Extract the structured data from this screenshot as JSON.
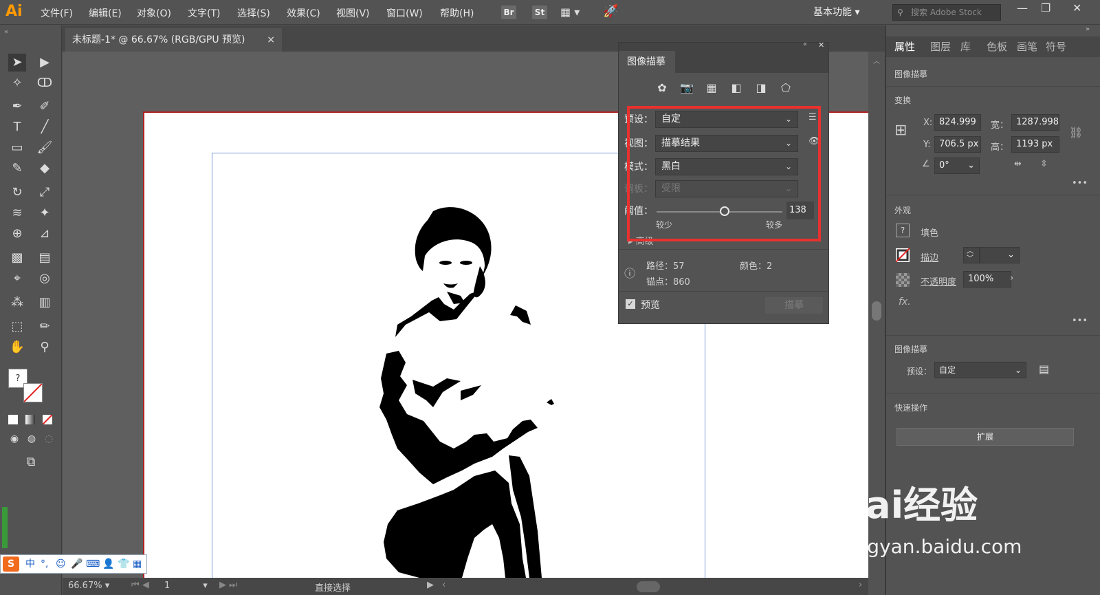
{
  "app": {
    "logo": "Ai",
    "menus": [
      "文件(F)",
      "编辑(E)",
      "对象(O)",
      "文字(T)",
      "选择(S)",
      "效果(C)",
      "视图(V)",
      "窗口(W)",
      "帮助(H)"
    ],
    "bridge": [
      "Br",
      "St"
    ],
    "workspace": "基本功能",
    "stock_placeholder": "搜索 Adobe Stock"
  },
  "document": {
    "tab": "未标题-1* @ 66.67% (RGB/GPU 预览)",
    "close": "×"
  },
  "trace_panel": {
    "title": "图像描摹",
    "preset_label": "预设：",
    "preset_value": "自定",
    "view_label": "视图：",
    "view_value": "描摹结果",
    "mode_label": "模式：",
    "mode_value": "黑白",
    "palette_label": "调板：",
    "palette_value": "受限",
    "threshold_label": "阈值：",
    "threshold_value": "138",
    "threshold_fraction": 0.54,
    "less": "较少",
    "more": "较多",
    "advanced": "高级",
    "paths_label": "路径：",
    "paths_value": "57",
    "colors_label": "颜色：",
    "colors_value": "2",
    "anchors_label": "锚点：",
    "anchors_value": "860",
    "preview": "预览",
    "trace_button": "描摹"
  },
  "props_panel": {
    "tabs": [
      "属性",
      "图层",
      "库",
      "色板",
      "画笔",
      "符号"
    ],
    "section_trace": "图像描摹",
    "transform": "变换",
    "x_label": "X:",
    "x_value": "824.999",
    "y_label": "Y:",
    "y_value": "706.5 px",
    "w_label": "宽：",
    "w_value": "1287.998",
    "h_label": "高：",
    "h_value": "1193 px",
    "angle_value": "0°",
    "appearance": "外观",
    "fill": "填色",
    "stroke": "描边",
    "opacity_label": "不透明度",
    "opacity_value": "100%",
    "fx": "fx.",
    "trace_section2": "图像描摹",
    "preset_label": "预设：",
    "preset_value": "自定",
    "quick_actions": "快速操作",
    "expand_button": "扩展"
  },
  "status": {
    "zoom": "66.67%",
    "page": "1",
    "tool": "直接选择"
  },
  "ime": {
    "items": [
      "中",
      "°,",
      "☺",
      "🎤",
      "⌨",
      "👤",
      "👕",
      "▦"
    ]
  },
  "watermark": {
    "brand": "Bai经验",
    "url": "jingyan.baidu.com"
  }
}
